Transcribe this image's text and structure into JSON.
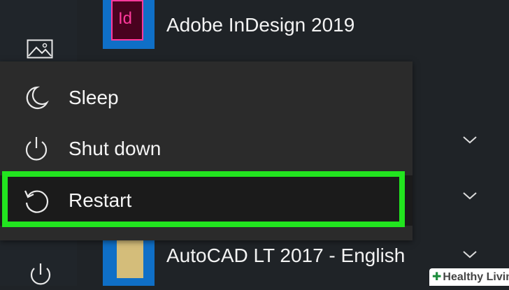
{
  "start_menu": {
    "apps": [
      {
        "label": "Adobe InDesign 2019",
        "tile_text": "Id",
        "icon": "indesign-icon"
      },
      {
        "label": "AutoCAD LT 2017 - English",
        "icon": "folder-icon"
      }
    ],
    "left_rail": {
      "pictures_icon": "image-icon",
      "power_icon": "power-icon"
    }
  },
  "power_menu": {
    "items": [
      {
        "label": "Sleep",
        "icon": "moon-icon"
      },
      {
        "label": "Shut down",
        "icon": "power-icon"
      },
      {
        "label": "Restart",
        "icon": "restart-icon",
        "highlighted": true
      }
    ],
    "highlight_color": "#22e51f"
  },
  "watermark": {
    "text": "Healthy Living"
  },
  "colors": {
    "background": "#1f2327",
    "tile_blue": "#0f6fc7",
    "menu_bg": "#2b2b2b",
    "indesign_pink": "#ff3a9c"
  }
}
